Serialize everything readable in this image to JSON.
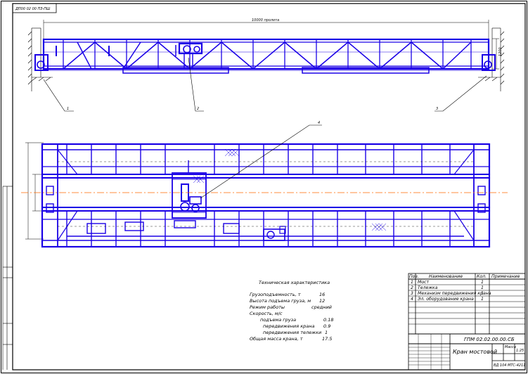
{
  "stamp_top": "ДП00 02 00 ПЗ-ПШ",
  "dimension_span": "10000 пролета",
  "dimension_height": "1200",
  "callouts": [
    "1",
    "2",
    "3",
    "4"
  ],
  "tech": {
    "title": "Техническая характеристика",
    "rows": [
      {
        "label": "Грузоподъемность, т",
        "value": "16"
      },
      {
        "label": "Высота подъема груза, м",
        "value": "12"
      },
      {
        "label": "Режим работы",
        "value": "средний"
      },
      {
        "label": "Скорость, м/с",
        "value": ""
      },
      {
        "label": "подъема груза",
        "value": "0.18"
      },
      {
        "label": "передвижения крана",
        "value": "0.9"
      },
      {
        "label": "передвижения тележки",
        "value": "1"
      },
      {
        "label": "Общая масса крана, т",
        "value": "17.5"
      }
    ]
  },
  "parts_table": {
    "headers": [
      "Поз.",
      "Наименование",
      "Кол.",
      "Примечание"
    ],
    "rows": [
      {
        "pos": "1",
        "name": "Мост",
        "qty": "1",
        "note": ""
      },
      {
        "pos": "2",
        "name": "Тележка",
        "qty": "1",
        "note": ""
      },
      {
        "pos": "3",
        "name": "Механизм передвижения крана",
        "qty": "1",
        "note": ""
      },
      {
        "pos": "4",
        "name": "Эл. оборудование крана",
        "qty": "1",
        "note": ""
      }
    ]
  },
  "title_block": {
    "code": "ГПМ 02.02.00.00.СБ",
    "name": "Кран мостовой",
    "sheet_label": "Масса",
    "scale": "1:25",
    "group": "ВД 104 МТС-4211"
  },
  "colors": {
    "frame": "#000000",
    "steel": "#1a00e6",
    "axis": "#ff6a00"
  }
}
